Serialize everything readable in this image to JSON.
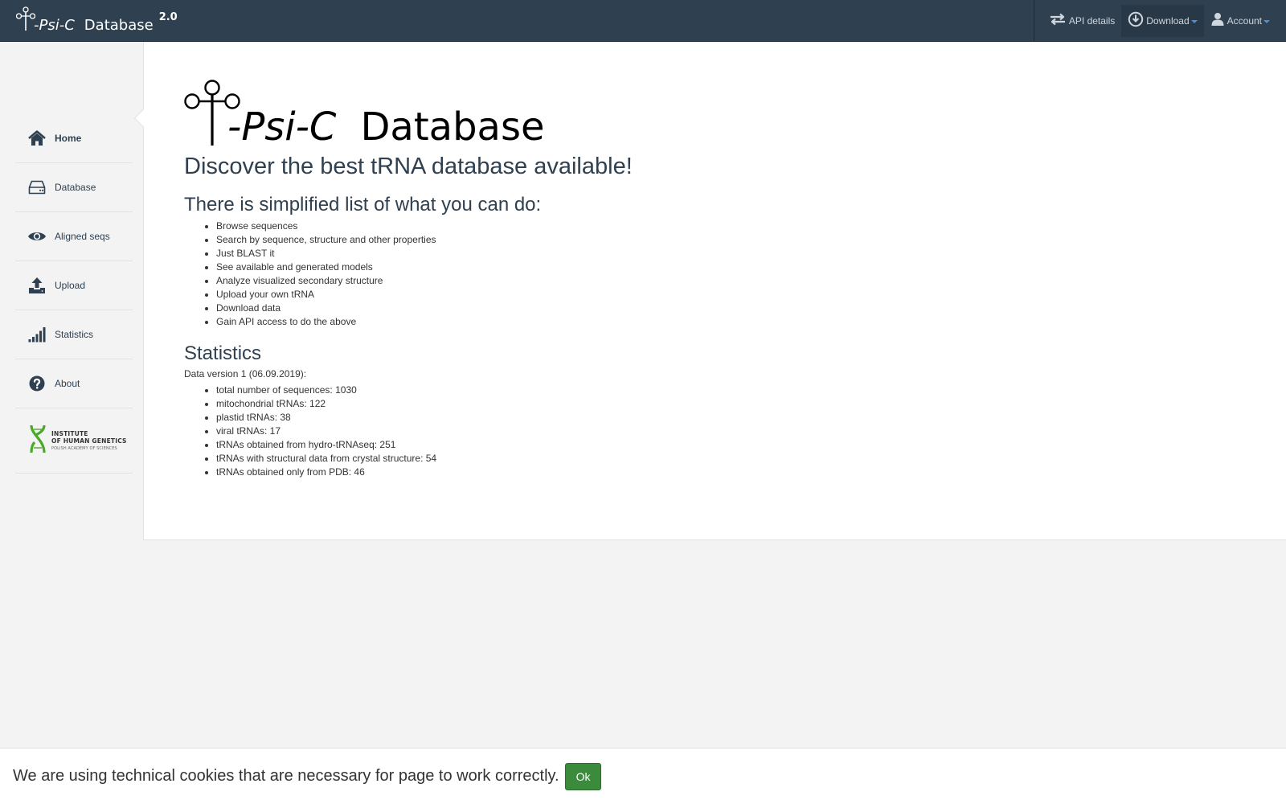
{
  "navbar": {
    "brand_name": "-Psi-C",
    "brand_suffix": "Database",
    "brand_version": "2.0",
    "items": [
      {
        "label": "API details",
        "icon": "transfer-arrows-icon"
      },
      {
        "label": "Download",
        "icon": "download-circle-icon",
        "has_caret": true
      },
      {
        "label": "Account",
        "icon": "user-icon",
        "has_caret": true
      }
    ]
  },
  "sidebar": {
    "items": [
      {
        "label": "Home",
        "icon": "home-icon",
        "active": true
      },
      {
        "label": "Database",
        "icon": "hard-drive-icon"
      },
      {
        "label": "Aligned seqs",
        "icon": "eye-icon"
      },
      {
        "label": "Upload",
        "icon": "upload-icon"
      },
      {
        "label": "Statistics",
        "icon": "signal-bars-icon"
      },
      {
        "label": "About",
        "icon": "question-circle-icon"
      }
    ],
    "logo": {
      "line1": "INSTITUTE",
      "line2": "OF HUMAN GENETICS",
      "line3": "POLISH ACADEMY OF SCIENCES"
    }
  },
  "main": {
    "logo_name": "-Psi-C",
    "logo_suffix": "Database",
    "tagline": "Discover the best tRNA database available!",
    "features_heading": "There is simplified list of what you can do:",
    "features": [
      "Browse sequences",
      "Search by sequence, structure and other properties",
      "Just BLAST it",
      "See available and generated models",
      "Analyze visualized secondary structure",
      "Upload your own tRNA",
      "Download data",
      "Gain API access to do the above"
    ],
    "stats_heading": "Statistics",
    "data_version": "Data version 1 (06.09.2019):",
    "stats": [
      "total number of sequences: 1030",
      "mitochondrial tRNAs: 122",
      "plastid tRNAs: 38",
      "viral tRNAs: 17",
      "tRNAs obtained from hydro-tRNAseq: 251",
      "tRNAs with structural data from crystal structure: 54",
      "tRNAs obtained only from PDB: 46"
    ]
  },
  "cookie": {
    "message": "We are using technical cookies that are necessary for page to work correctly.",
    "button": "Ok"
  },
  "colors": {
    "navbar_bg": "#2f4050",
    "sidebar_bg": "#f3f3f4",
    "text_heading": "#2f4050",
    "ok_button": "#3c8b3c",
    "caret_accent": "#4a90d9"
  }
}
